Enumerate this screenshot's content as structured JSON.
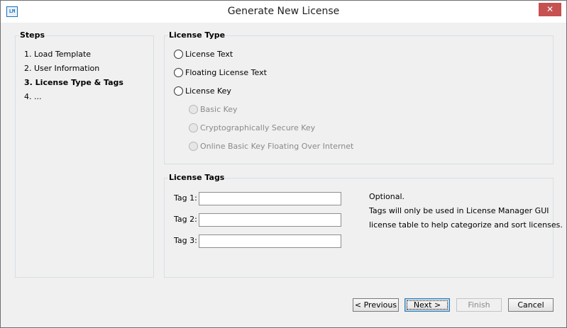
{
  "window": {
    "title": "Generate New License",
    "icon_name": "app-license-icon",
    "icon_text": "LM",
    "close_glyph": "✕"
  },
  "steps": {
    "title": "Steps",
    "items": [
      {
        "label": "1. Load Template",
        "current": false
      },
      {
        "label": "2. User Information",
        "current": false
      },
      {
        "label": "3. License Type & Tags",
        "current": true
      },
      {
        "label": "4. ...",
        "current": false
      }
    ]
  },
  "license_type": {
    "title": "License Type",
    "options": [
      {
        "label": "License Text",
        "selected": false,
        "enabled": true
      },
      {
        "label": "Floating License Text",
        "selected": false,
        "enabled": true
      },
      {
        "label": "License Key",
        "selected": false,
        "enabled": true
      }
    ],
    "key_options": [
      {
        "label": "Basic Key",
        "selected": false,
        "enabled": false
      },
      {
        "label": "Cryptographically Secure Key",
        "selected": false,
        "enabled": false
      },
      {
        "label": "Online Basic Key Floating Over Internet",
        "selected": false,
        "enabled": false
      }
    ]
  },
  "license_tags": {
    "title": "License Tags",
    "fields": [
      {
        "label": "Tag 1:",
        "value": ""
      },
      {
        "label": "Tag 2:",
        "value": ""
      },
      {
        "label": "Tag 3:",
        "value": ""
      }
    ],
    "note_lines": [
      "Optional.",
      "Tags will only be used in License Manager GUI",
      "license table to help categorize and sort licenses."
    ]
  },
  "buttons": {
    "previous": "< Previous",
    "next": "Next >",
    "finish": "Finish",
    "cancel": "Cancel"
  }
}
